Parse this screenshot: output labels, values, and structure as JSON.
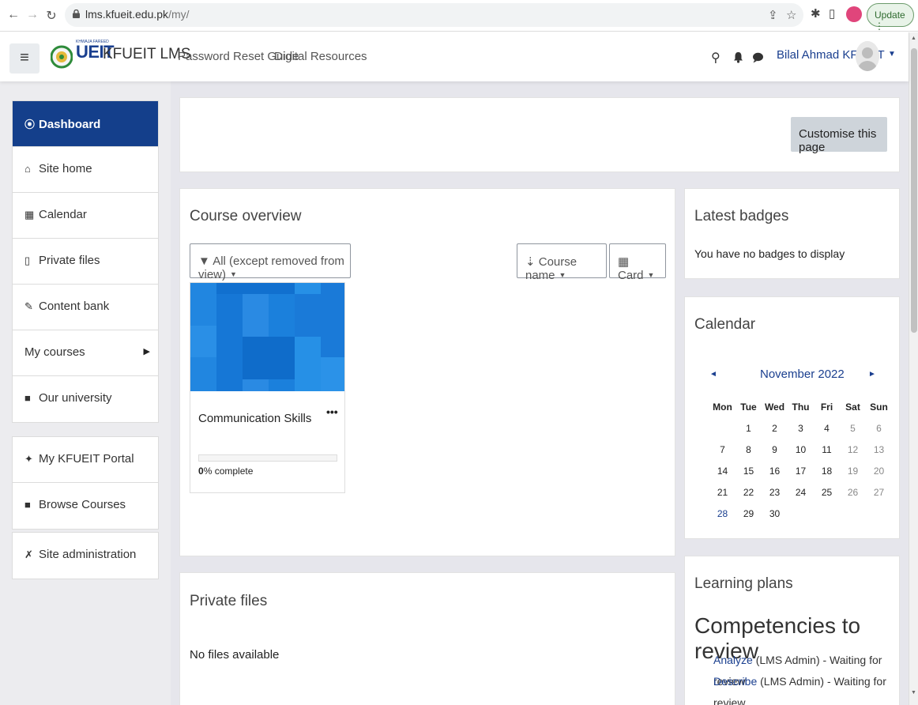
{
  "browser": {
    "url_host": "lms.kfueit.edu.pk",
    "url_path": "/my/",
    "update_label": "Update"
  },
  "navbar": {
    "toggle_glyph": "≡",
    "logo_text": "UEIT",
    "logo_subtext": "KHWAJA FAREED",
    "site_name": "KFUEIT LMS",
    "links": [
      "Password Reset Guide",
      "Digital Resources"
    ],
    "user_name": "Bilal Ahmad KFUEIT"
  },
  "sidebar": {
    "group1": [
      {
        "label": "Dashboard",
        "icon": "dashboard-icon",
        "glyph": "⦿"
      },
      {
        "label": "Site home",
        "icon": "home-icon",
        "glyph": "⌂"
      },
      {
        "label": "Calendar",
        "icon": "calendar-icon",
        "glyph": "▦"
      },
      {
        "label": "Private files",
        "icon": "file-icon",
        "glyph": "▯"
      },
      {
        "label": "Content bank",
        "icon": "brush-icon",
        "glyph": "✎"
      },
      {
        "label": "My courses",
        "icon": "",
        "glyph": ""
      },
      {
        "label": "Our university",
        "icon": "square-icon",
        "glyph": "■"
      }
    ],
    "group2": [
      {
        "label": "My KFUEIT Portal",
        "icon": "graduation-cap-icon",
        "glyph": "✦"
      },
      {
        "label": "Browse Courses",
        "icon": "square-icon",
        "glyph": "■"
      }
    ],
    "group3": [
      {
        "label": "Site administration",
        "icon": "wrench-icon",
        "glyph": "✗"
      }
    ]
  },
  "header_block": {
    "customise_label": "Customise this page"
  },
  "course_overview": {
    "title": "Course overview",
    "filter_label": "All (except removed from view)",
    "sort_label": "Course name",
    "view_label": "Card",
    "courses": [
      {
        "name": "Communication Skills",
        "progress_percent": 0,
        "progress_value": "0",
        "progress_suffix": "% complete"
      }
    ]
  },
  "private_files": {
    "title": "Private files",
    "empty_text": "No files available"
  },
  "badges": {
    "title": "Latest badges",
    "empty_text": "You have no badges to display"
  },
  "calendar": {
    "title": "Calendar",
    "month": "November 2022",
    "prev_glyph": "◄",
    "next_glyph": "►",
    "weekdays": [
      "Mon",
      "Tue",
      "Wed",
      "Thu",
      "Fri",
      "Sat",
      "Sun"
    ],
    "weeks": [
      [
        "",
        "1",
        "2",
        "3",
        "4",
        "5",
        "6"
      ],
      [
        "7",
        "8",
        "9",
        "10",
        "11",
        "12",
        "13"
      ],
      [
        "14",
        "15",
        "16",
        "17",
        "18",
        "19",
        "20"
      ],
      [
        "21",
        "22",
        "23",
        "24",
        "25",
        "26",
        "27"
      ],
      [
        "28",
        "29",
        "30",
        "",
        "",
        "",
        ""
      ]
    ],
    "today": "28"
  },
  "learning_plans": {
    "title": "Learning plans",
    "heading": "Competencies to review",
    "items": [
      {
        "link": "Analyze",
        "rest": " (LMS Admin) - Waiting for review"
      },
      {
        "link": "Describe",
        "rest": " (LMS Admin) - Waiting for review"
      }
    ]
  },
  "colors": {
    "brand_blue": "#143f8b",
    "link_blue": "#1a3f8f",
    "course_image_blue": "#1a7ad8"
  }
}
